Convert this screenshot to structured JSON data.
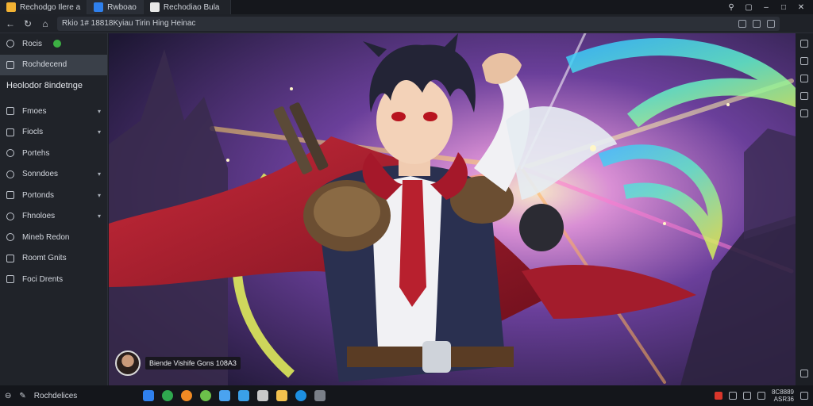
{
  "tabs": [
    {
      "label": "Rechodgo Ilere a",
      "icon": "app-icon",
      "color": "#f2b233"
    },
    {
      "label": "Rwboao",
      "icon": "ae-icon",
      "color": "#2f80ed"
    },
    {
      "label": "Rechodiao Bula",
      "icon": "image-app-icon",
      "color": "#e8e8e8"
    }
  ],
  "addressbar": {
    "url": "Rkio 1# 18818Kyiau Tirin Hing Heinac"
  },
  "sidebar": {
    "top_item": "Rocis",
    "active_item": "Rochdecend",
    "header": "Heolodor 8indetnge",
    "items": [
      {
        "label": "Fmoes",
        "icon": "square-icon",
        "chevron": true
      },
      {
        "label": "Fiocls",
        "icon": "file-icon",
        "chevron": true
      },
      {
        "label": "Portehs",
        "icon": "circle-icon",
        "chevron": false
      },
      {
        "label": "Sonndoes",
        "icon": "search-icon",
        "chevron": true
      },
      {
        "label": "Portonds",
        "icon": "tag-icon",
        "chevron": true
      },
      {
        "label": "Fhnoloes",
        "icon": "clock-icon",
        "chevron": true
      },
      {
        "label": "Mineb Redon",
        "icon": "globe-icon",
        "chevron": false
      },
      {
        "label": "Roomt Gnits",
        "icon": "box-icon",
        "chevron": false
      },
      {
        "label": "Foci Drents",
        "icon": "list-icon",
        "chevron": false
      }
    ]
  },
  "caption": {
    "text": "Biende Vishife Gons 108A3"
  },
  "taskbar": {
    "search_label": "Rochdelices",
    "apps": [
      {
        "name": "folder-app-icon",
        "color": "#2f80ed"
      },
      {
        "name": "green-app-icon",
        "color": "#2fa84f"
      },
      {
        "name": "firefox-icon",
        "color": "#f08a24"
      },
      {
        "name": "spotify-icon",
        "color": "#6cc04a"
      },
      {
        "name": "store-icon",
        "color": "#4aa3f0"
      },
      {
        "name": "bird-app-icon",
        "color": "#3aa0e8"
      },
      {
        "name": "doc-app-icon",
        "color": "#c8c8c8"
      },
      {
        "name": "notes-app-icon",
        "color": "#f2c14e"
      },
      {
        "name": "chat-app-icon",
        "color": "#1d8fe1"
      },
      {
        "name": "shield-app-icon",
        "color": "#7a7f88"
      }
    ],
    "clock_time": "8C8889",
    "clock_date": "ASR36"
  }
}
